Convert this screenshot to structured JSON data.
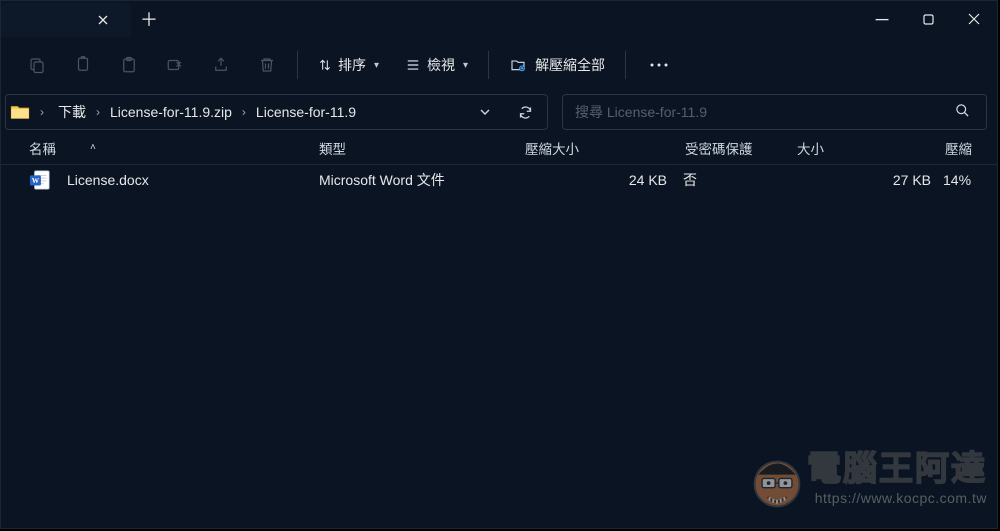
{
  "titlebar": {
    "tab_title": ""
  },
  "toolbar": {
    "sort_label": "排序",
    "view_label": "檢視",
    "extract_label": "解壓縮全部"
  },
  "breadcrumb": {
    "segs": [
      "下載",
      "License-for-11.9.zip",
      "License-for-11.9"
    ]
  },
  "search": {
    "placeholder": "搜尋 License-for-11.9"
  },
  "columns": {
    "name": "名稱",
    "type": "類型",
    "compressed": "壓縮大小",
    "protected": "受密碼保護",
    "size": "大小",
    "ratio": "壓縮"
  },
  "files": [
    {
      "name": "License.docx",
      "type": "Microsoft Word 文件",
      "compressed": "24 KB",
      "protected": "否",
      "size": "27 KB",
      "ratio": "14%"
    }
  ],
  "watermark": {
    "text": "電腦王阿達",
    "url": "https://www.kocpc.com.tw"
  }
}
